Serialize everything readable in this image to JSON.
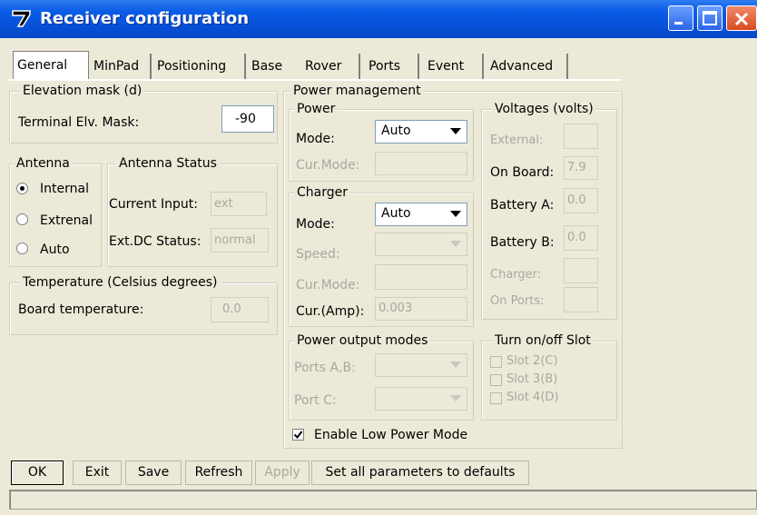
{
  "window": {
    "title": "Receiver configuration",
    "icon": "app-logo-icon",
    "controls": [
      "minimize-icon",
      "maximize-icon",
      "close-icon"
    ]
  },
  "tabs": [
    {
      "label": "General",
      "active": true
    },
    {
      "label": "MinPad",
      "active": false
    },
    {
      "label": "Positioning",
      "active": false
    },
    {
      "label": "Base",
      "active": false
    },
    {
      "label": "Rover",
      "active": false
    },
    {
      "label": "Ports",
      "active": false
    },
    {
      "label": "Event",
      "active": false
    },
    {
      "label": "Advanced",
      "active": false
    }
  ],
  "elevation": {
    "group_label": "Elevation mask (d)",
    "field_label": "Terminal Elv. Mask:",
    "value": "-90"
  },
  "antenna": {
    "group_label": "Antenna",
    "options": [
      "Internal",
      "Extrenal",
      "Auto"
    ],
    "selected": "Internal"
  },
  "antenna_status": {
    "group_label": "Antenna Status",
    "current_input_label": "Current Input:",
    "current_input_value": "ext",
    "extdc_label": "Ext.DC Status:",
    "extdc_value": "normal"
  },
  "temperature": {
    "group_label": "Temperature (Celsius degrees)",
    "label": "Board temperature:",
    "value": "0.0"
  },
  "power_management": {
    "group_label": "Power management",
    "power": {
      "group_label": "Power",
      "mode_label": "Mode:",
      "mode_value": "Auto",
      "cur_mode_label": "Cur.Mode:",
      "cur_mode_value": ""
    },
    "charger": {
      "group_label": "Charger",
      "mode_label": "Mode:",
      "mode_value": "Auto",
      "speed_label": "Speed:",
      "speed_value": "",
      "cur_mode_label": "Cur.Mode:",
      "cur_mode_value": "",
      "cur_amp_label": "Cur.(Amp):",
      "cur_amp_value": "0.003"
    },
    "voltages": {
      "group_label": "Voltages (volts)",
      "external_label": "External:",
      "external_value": "",
      "onboard_label": "On Board:",
      "onboard_value": "7.9",
      "battery_a_label": "Battery A:",
      "battery_a_value": "0.0",
      "battery_b_label": "Battery B:",
      "battery_b_value": "0.0",
      "charger_label": "Charger:",
      "charger_value": "",
      "onports_label": "On Ports:",
      "onports_value": ""
    },
    "output_modes": {
      "group_label": "Power output modes",
      "ports_ab_label": "Ports A,B:",
      "port_c_label": "Port C:"
    },
    "slots": {
      "group_label": "Turn on/off Slot",
      "items": [
        "Slot 2(C)",
        "Slot 3(B)",
        "Slot 4(D)"
      ]
    },
    "low_power_label": "Enable Low Power Mode",
    "low_power_checked": true
  },
  "buttons": {
    "ok": "OK",
    "exit": "Exit",
    "save": "Save",
    "refresh": "Refresh",
    "apply": "Apply",
    "defaults": "Set all parameters to defaults"
  },
  "colors": {
    "titlebar": "#0a5ce6",
    "dialog_bg": "#ece9d8",
    "disabled_text": "#a8a8a0",
    "close_button": "#d84a20"
  }
}
